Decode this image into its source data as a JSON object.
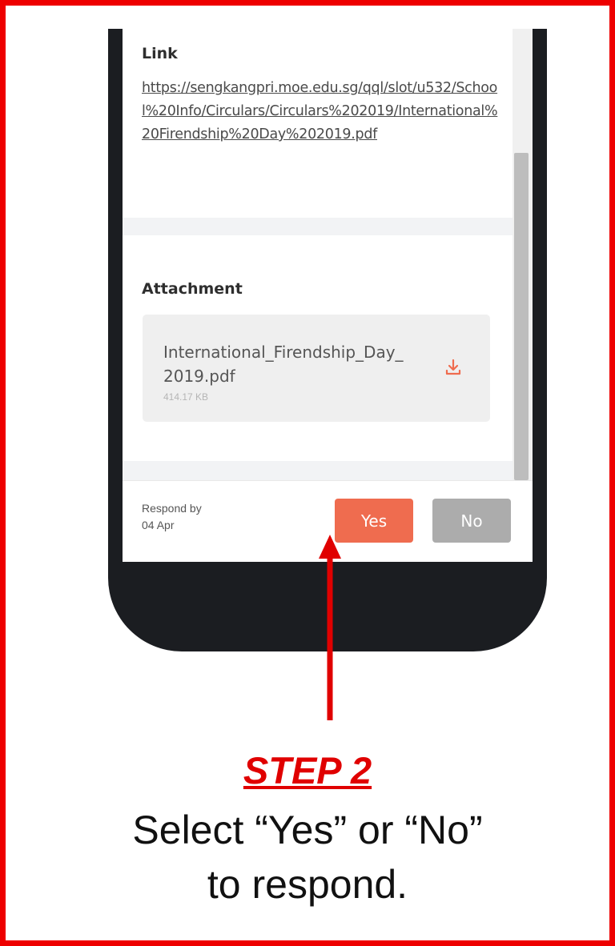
{
  "link_section": {
    "label": "Link",
    "url": "https://sengkangpri.moe.edu.sg/qql/slot/u532/School%20Info/Circulars/Circulars%202019/International%20Firendship%20Day%202019.pdf"
  },
  "attachment_section": {
    "label": "Attachment",
    "file_name": "International_Firendship_Day_2019.pdf",
    "file_size": "414.17 KB",
    "download_icon": "download-icon"
  },
  "footer": {
    "respond_label": "Respond by",
    "respond_date": "04 Apr",
    "yes_label": "Yes",
    "no_label": "No"
  },
  "annotation": {
    "step_title": "STEP 2",
    "instruction_line1": "Select “Yes” or “No”",
    "instruction_line2": "to respond."
  },
  "colors": {
    "border": "#ee0000",
    "accent": "#ef6c4f",
    "no_button": "#acacac",
    "phone_body": "#1b1d21"
  }
}
